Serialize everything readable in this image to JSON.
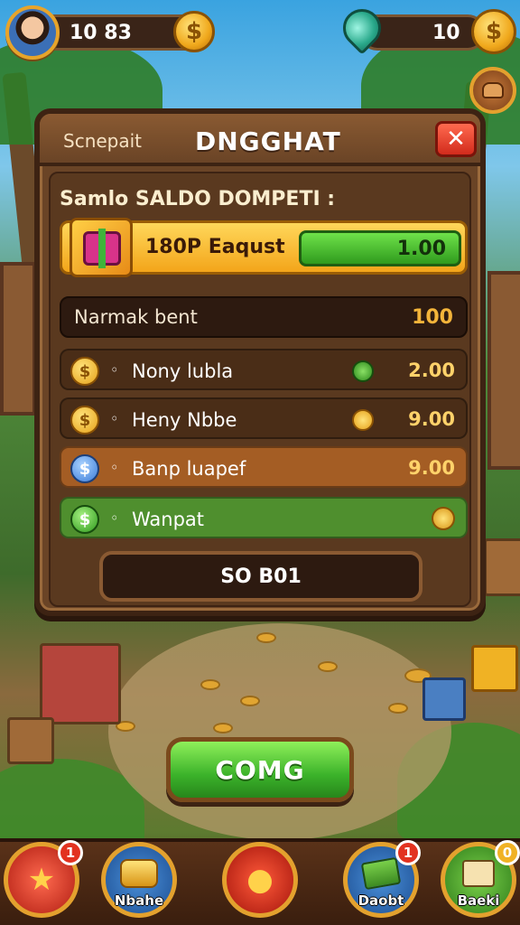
{
  "hud": {
    "player_coins": "10 83",
    "coin_symbol": "$",
    "gem_count": "10",
    "currency_symbol": "$"
  },
  "panel": {
    "header_left": "Scnepait",
    "title": "DNGGHAT",
    "close_symbol": "✕",
    "section_title": "Samlo SALDO DOMPETI :",
    "offer": {
      "label": "180P Eaqust",
      "value": "1.00"
    },
    "table_header": {
      "label": "Narmak bent",
      "value": "100"
    },
    "rows": [
      {
        "icon": "$",
        "bullet": "◦",
        "name": "Nony lubla",
        "value": "2.00"
      },
      {
        "icon": "$",
        "bullet": "◦",
        "name": "Heny Nbbe",
        "value": "9.00"
      },
      {
        "icon": "$",
        "bullet": "◦",
        "name": "Banp luapef",
        "value": "9.00"
      },
      {
        "icon": "$",
        "bullet": "◦",
        "name": "Wanpat",
        "value": ""
      }
    ],
    "footer_value": "SO B01"
  },
  "cta": {
    "label": "COMG"
  },
  "bottom_nav": {
    "items": [
      {
        "label": "",
        "badge": "1"
      },
      {
        "label": "Nbahe",
        "badge": ""
      },
      {
        "label": "",
        "badge": ""
      },
      {
        "label": "Daobt",
        "badge": "1"
      },
      {
        "label": "Baeki",
        "badge": "0"
      }
    ]
  },
  "colors": {
    "panel_wood": "#6a4426",
    "accent_green": "#3bb22a",
    "accent_gold": "#f3a51a",
    "close_red": "#d22b1c"
  }
}
